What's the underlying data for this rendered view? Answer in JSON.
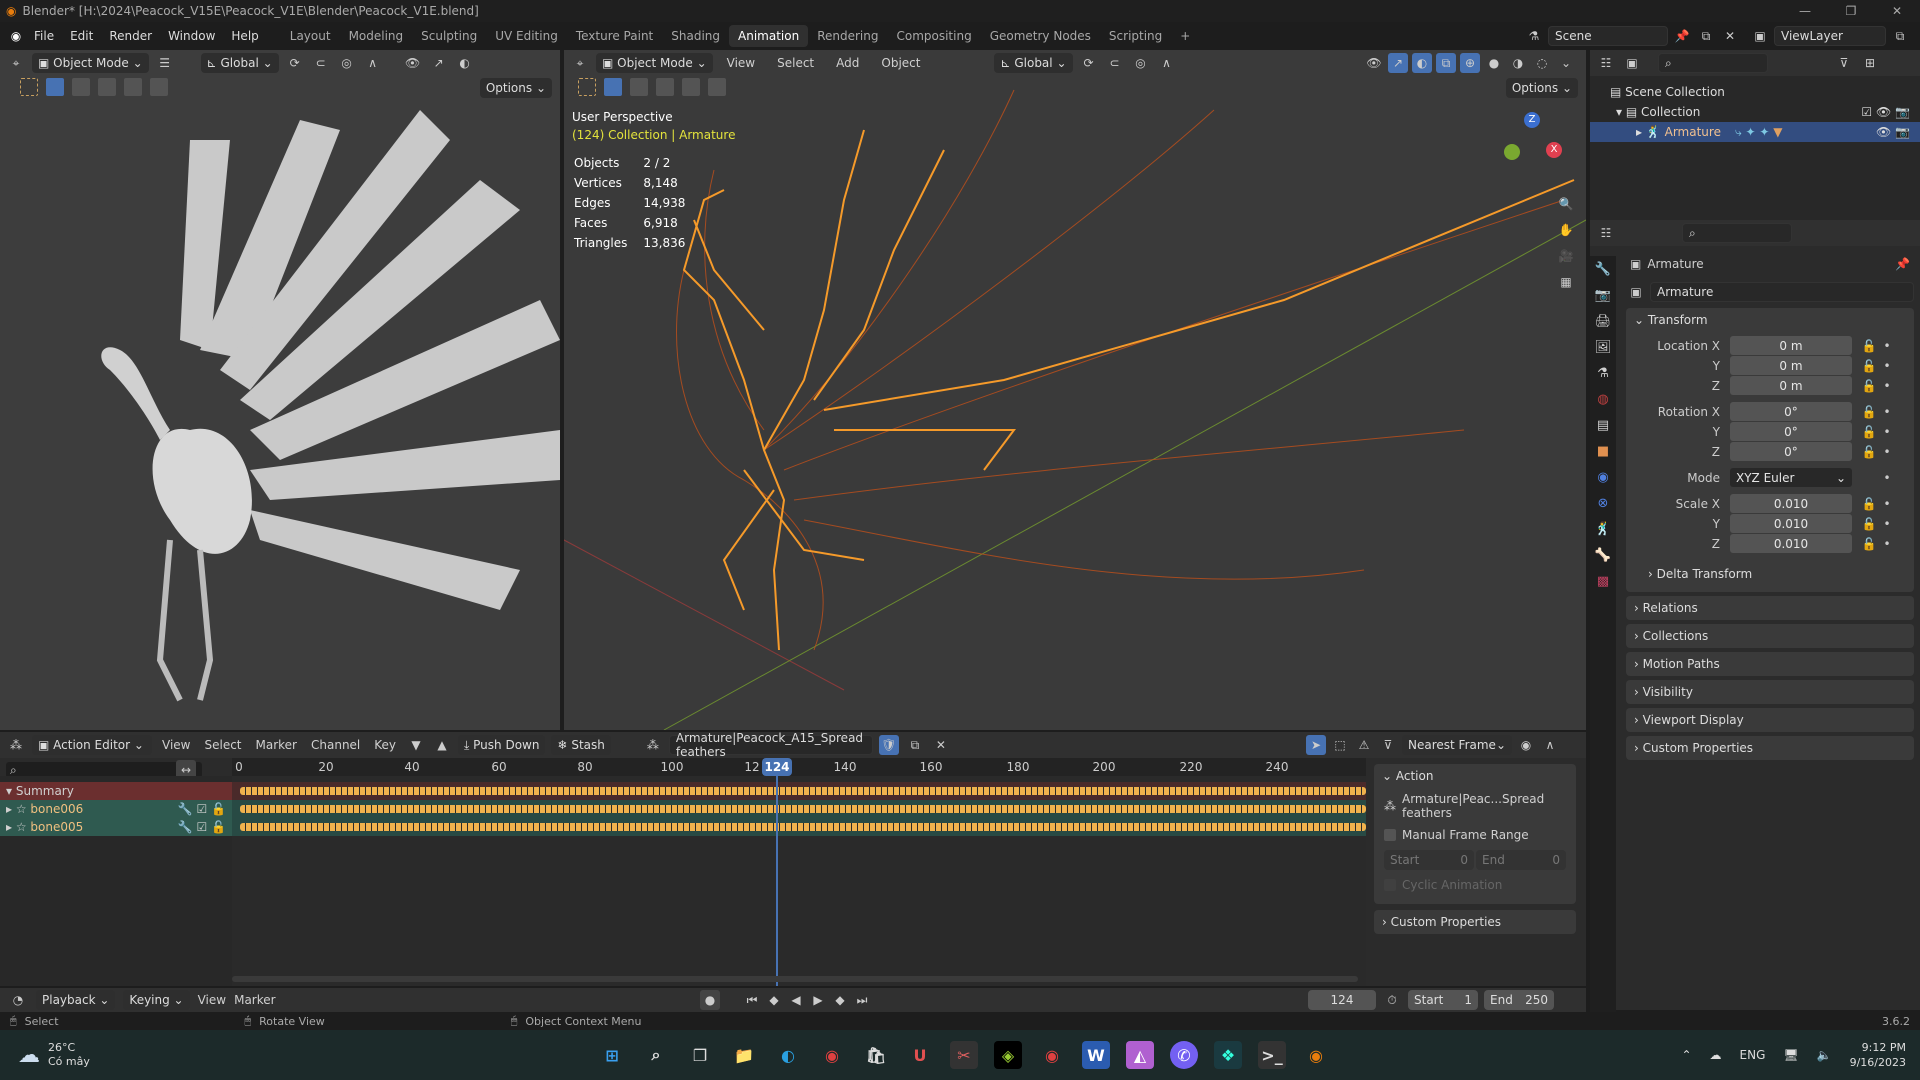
{
  "window": {
    "title": "Blender* [H:\\2024\\Peacock_V15E\\Peacock_V1E\\Blender\\Peacock_V1E.blend]",
    "controls": [
      "—",
      "❐",
      "✕"
    ]
  },
  "menubar": {
    "items": [
      "File",
      "Edit",
      "Render",
      "Window",
      "Help"
    ],
    "workspaces": [
      "Layout",
      "Modeling",
      "Sculpting",
      "UV Editing",
      "Texture Paint",
      "Shading",
      "Animation",
      "Rendering",
      "Compositing",
      "Geometry Nodes",
      "Scripting",
      "+"
    ],
    "active_workspace": "Animation",
    "scene": "Scene",
    "view_layer": "ViewLayer"
  },
  "viewport_left": {
    "mode": "Object Mode",
    "orientation": "Global",
    "options_label": "Options"
  },
  "viewport_main": {
    "mode": "Object Mode",
    "menus": [
      "View",
      "Select",
      "Add",
      "Object"
    ],
    "orientation": "Global",
    "options_label": "Options",
    "perspective": "User Perspective",
    "context": "(124) Collection | Armature",
    "stats": [
      {
        "label": "Objects",
        "value": "2 / 2"
      },
      {
        "label": "Vertices",
        "value": "8,148"
      },
      {
        "label": "Edges",
        "value": "14,938"
      },
      {
        "label": "Faces",
        "value": "6,918"
      },
      {
        "label": "Triangles",
        "value": "13,836"
      }
    ],
    "gizmo_axes": [
      "Z",
      "X",
      "Y"
    ]
  },
  "outliner": {
    "scene_collection": "Scene Collection",
    "collection": "Collection",
    "armature": "Armature"
  },
  "properties": {
    "object_name": "Armature",
    "data_name": "Armature",
    "transform_label": "Transform",
    "location": {
      "label": "Location X",
      "x": "0 m",
      "y": "0 m",
      "z": "0 m"
    },
    "rotation": {
      "label": "Rotation X",
      "x": "0°",
      "y": "0°",
      "z": "0°"
    },
    "mode_label": "Mode",
    "mode_value": "XYZ Euler",
    "scale": {
      "label": "Scale X",
      "x": "0.010",
      "y": "0.010",
      "z": "0.010"
    },
    "axis_y": "Y",
    "axis_z": "Z",
    "delta_transform": "Delta Transform",
    "sections": [
      "Relations",
      "Collections",
      "Motion Paths",
      "Visibility",
      "Viewport Display",
      "Custom Properties"
    ]
  },
  "action_editor": {
    "editor_mode": "Action Editor",
    "menus": [
      "View",
      "Select",
      "Marker",
      "Channel",
      "Key"
    ],
    "push_down": "Push Down",
    "stash": "Stash",
    "action_name": "Armature|Peacock_A15_Spread feathers",
    "snap": "Nearest Frame",
    "channels": [
      {
        "name": "Summary",
        "type": "summary"
      },
      {
        "name": "bone006",
        "type": "bone"
      },
      {
        "name": "bone005",
        "type": "bone"
      }
    ],
    "ruler_ticks": [
      "0",
      "20",
      "40",
      "60",
      "80",
      "100",
      "12",
      "140",
      "160",
      "180",
      "200",
      "220",
      "240"
    ],
    "current_frame": "124",
    "side_panel": {
      "action_header": "Action",
      "action_name_short": "Armature|Peac...Spread feathers",
      "manual_frame_range": "Manual Frame Range",
      "start_label": "Start",
      "start_value": "0",
      "end_label": "End",
      "end_value": "0",
      "cyclic": "Cyclic Animation",
      "custom_properties": "Custom Properties"
    }
  },
  "timeline": {
    "menus": [
      "Playback",
      "Keying",
      "View",
      "Marker"
    ],
    "frame": "124",
    "start_label": "Start",
    "start": "1",
    "end_label": "End",
    "end": "250"
  },
  "statusbar": {
    "select": "Select",
    "rotate": "Rotate View",
    "context_menu": "Object Context Menu",
    "version": "3.6.2"
  },
  "taskbar": {
    "weather_temp": "26°C",
    "weather_desc": "Có mây",
    "language": "ENG",
    "time": "9:12 PM",
    "date": "9/16/2023",
    "apps": [
      "start",
      "search",
      "task-view",
      "file-explorer",
      "edge",
      "chrome",
      "store",
      "app-unikey",
      "app-snip",
      "app-green",
      "chrome-profile",
      "word",
      "affinity-photo",
      "viber",
      "filmora",
      "terminal",
      "blender"
    ]
  }
}
